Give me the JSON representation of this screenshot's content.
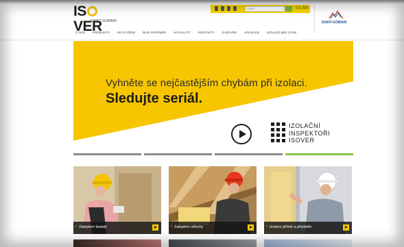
{
  "header": {
    "logo": {
      "word_left": "IS",
      "word_right": "VER",
      "sub": "SAINT-GOBAIN"
    },
    "topbar": {
      "search_placeholder": "Hledat",
      "lang": "CZ | EN"
    },
    "brand": {
      "name": "SAINT-GOBAIN"
    },
    "nav": [
      {
        "label": "O NÁS"
      },
      {
        "label": "PRODUKTY"
      },
      {
        "label": "KE STAŽENÍ"
      },
      {
        "label": "NAŠI PARTNEŘI"
      },
      {
        "label": "AKTUALITY"
      },
      {
        "label": "KONTAKTY"
      },
      {
        "label": "E-ISOVER"
      },
      {
        "label": "APLIKACE"
      },
      {
        "label": "IZOLACE BEZ CHYB"
      }
    ]
  },
  "hero": {
    "line1": "Vyhněte se nejčastějším chybám při izolaci.",
    "line2": "Sledujte seriál.",
    "inspectors": [
      "IZOLAČNÍ",
      "INSPEKTOŘI",
      "ISOVER"
    ],
    "slides": 4,
    "active_slide": 4
  },
  "tiles": [
    {
      "label": "Zateplení fasády"
    },
    {
      "label": "Zateplení střechy"
    },
    {
      "label": "Izolace příček a předstěn"
    }
  ],
  "colors": {
    "brand_yellow": "#f7c600",
    "dark": "#1d1d1b",
    "accent_green": "#8bc34a",
    "sg_blue": "#1f4e96"
  }
}
